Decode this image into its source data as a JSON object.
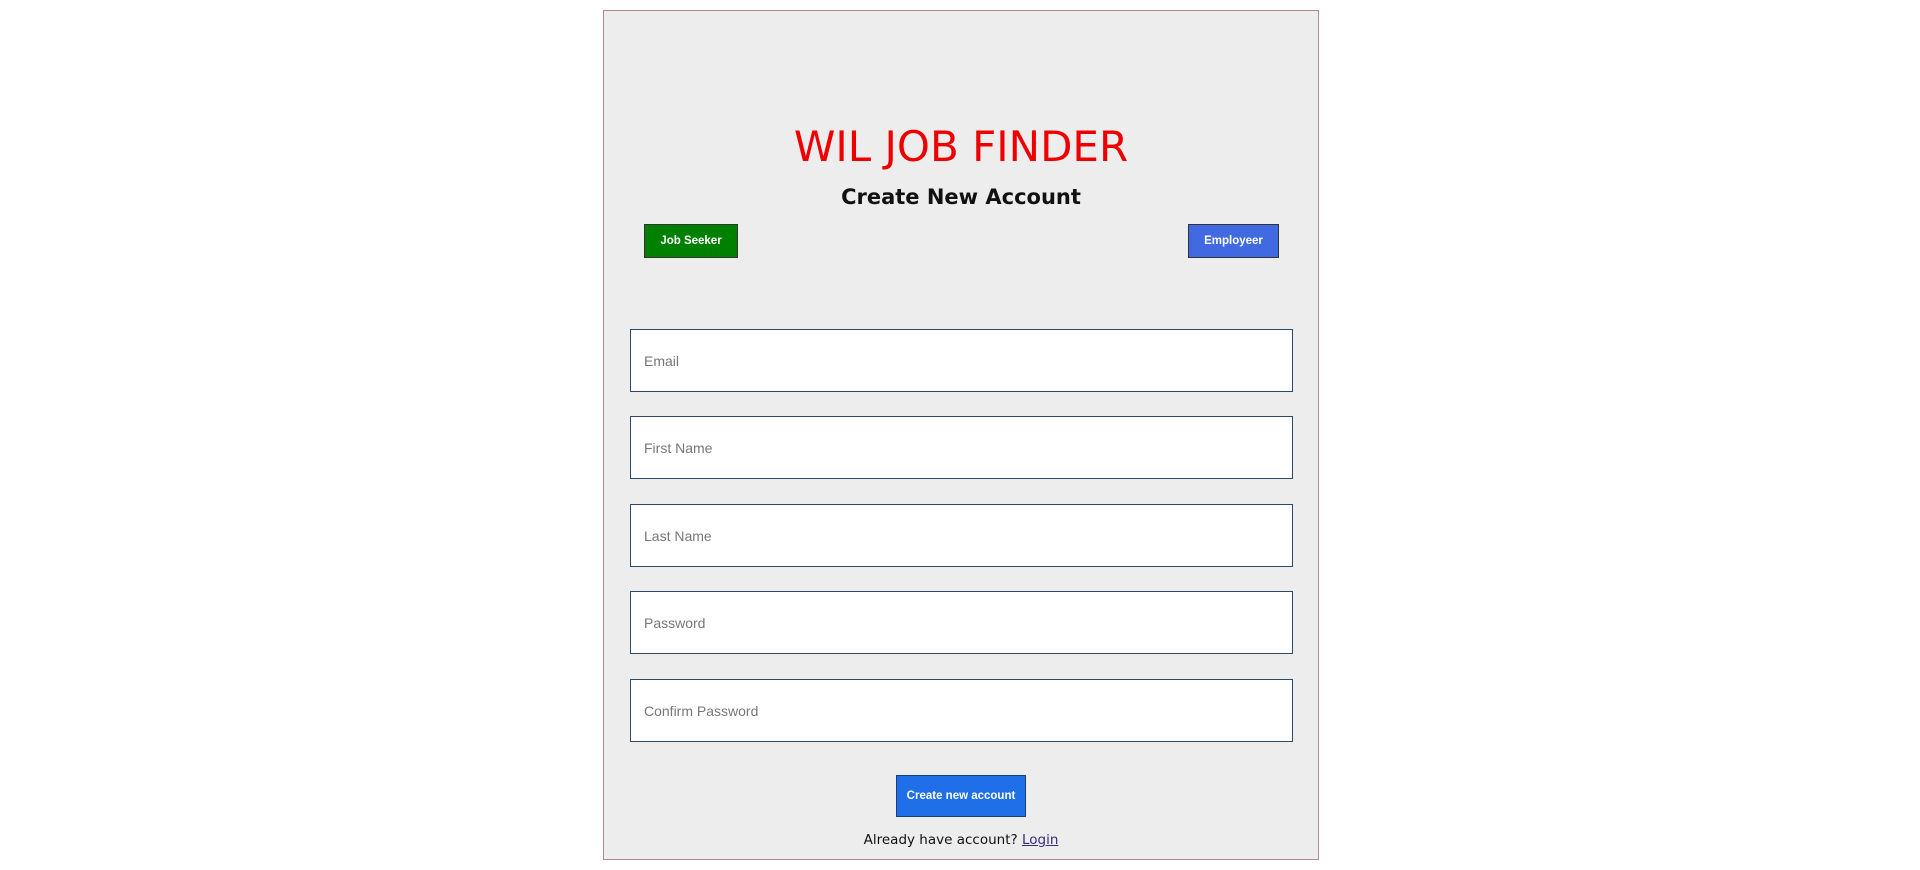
{
  "header": {
    "brand": "WIL JOB FINDER",
    "subtitle": "Create New Account",
    "brand_color": "#ee0000"
  },
  "roles": {
    "job_seeker_label": "Job Seeker",
    "job_seeker_color": "#008000",
    "employer_label": "Employeer",
    "employer_color": "#4169e1"
  },
  "form": {
    "email_placeholder": "Email",
    "email_value": "",
    "first_name_placeholder": "First Name",
    "first_name_value": "",
    "last_name_placeholder": "Last Name",
    "last_name_value": "",
    "password_placeholder": "Password",
    "password_value": "",
    "confirm_password_placeholder": "Confirm Password",
    "confirm_password_value": "",
    "submit_label": "Create new account",
    "submit_color": "#1f6fe8"
  },
  "footer": {
    "prompt_text": "Already have account? ",
    "login_label": "Login"
  }
}
